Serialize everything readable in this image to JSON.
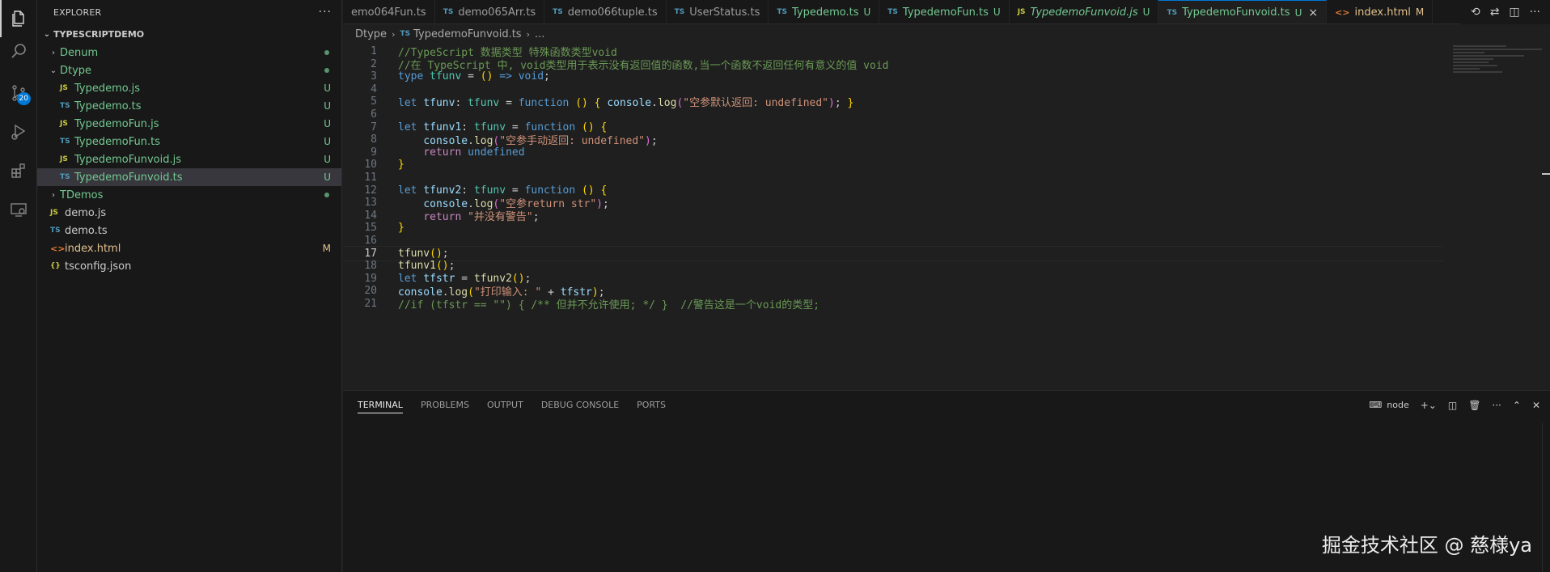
{
  "activity_bar": {
    "items": [
      {
        "icon": "files-icon"
      },
      {
        "icon": "search-icon"
      },
      {
        "icon": "source-control-icon",
        "badge": "20"
      },
      {
        "icon": "run-debug-icon"
      },
      {
        "icon": "extensions-icon"
      },
      {
        "icon": "remote-explorer-icon"
      }
    ]
  },
  "sidebar": {
    "title": "EXPLORER",
    "more": "···",
    "section": "TYPESCRIPTDEMO",
    "tree": [
      {
        "name": "Denum",
        "type": "folder",
        "open": false,
        "indent": 1,
        "color": "green",
        "dot": true
      },
      {
        "name": "Dtype",
        "type": "folder",
        "open": true,
        "indent": 1,
        "color": "green",
        "dot": true
      },
      {
        "name": "Typedemo.js",
        "type": "js",
        "indent": 2,
        "color": "green",
        "status": "U"
      },
      {
        "name": "Typedemo.ts",
        "type": "ts",
        "indent": 2,
        "color": "green",
        "status": "U"
      },
      {
        "name": "TypedemoFun.js",
        "type": "js",
        "indent": 2,
        "color": "green",
        "status": "U"
      },
      {
        "name": "TypedemoFun.ts",
        "type": "ts",
        "indent": 2,
        "color": "green",
        "status": "U"
      },
      {
        "name": "TypedemoFunvoid.js",
        "type": "js",
        "indent": 2,
        "color": "green",
        "status": "U"
      },
      {
        "name": "TypedemoFunvoid.ts",
        "type": "ts",
        "indent": 2,
        "color": "green",
        "status": "U",
        "selected": true
      },
      {
        "name": "TDemos",
        "type": "folder",
        "open": false,
        "indent": 1,
        "color": "green",
        "dot": true
      },
      {
        "name": "demo.js",
        "type": "js",
        "indent": 1,
        "color": "plain"
      },
      {
        "name": "demo.ts",
        "type": "ts",
        "indent": 1,
        "color": "plain"
      },
      {
        "name": "index.html",
        "type": "html",
        "indent": 1,
        "color": "orange",
        "status": "M"
      },
      {
        "name": "tsconfig.json",
        "type": "json",
        "indent": 1,
        "color": "plain"
      }
    ]
  },
  "tabs": [
    {
      "label": "emo064Fun.ts",
      "type": "",
      "mod": ""
    },
    {
      "label": "demo065Arr.ts",
      "type": "ts",
      "mod": ""
    },
    {
      "label": "demo066tuple.ts",
      "type": "ts",
      "mod": ""
    },
    {
      "label": "UserStatus.ts",
      "type": "ts",
      "mod": ""
    },
    {
      "label": "Typedemo.ts",
      "type": "ts",
      "mod": "U",
      "color": "green"
    },
    {
      "label": "TypedemoFun.ts",
      "type": "ts",
      "mod": "U",
      "color": "green"
    },
    {
      "label": "TypedemoFunvoid.js",
      "type": "js",
      "mod": "U",
      "color": "green",
      "italic": true
    },
    {
      "label": "TypedemoFunvoid.ts",
      "type": "ts",
      "mod": "U",
      "color": "green",
      "active": true
    },
    {
      "label": "index.html",
      "type": "html",
      "mod": "M",
      "color": "orange"
    }
  ],
  "tab_type_labels": {
    "ts": "TS",
    "js": "JS",
    "html": "<>"
  },
  "tab_close": "×",
  "breadcrumb": {
    "folder": "Dtype",
    "file_icon": "TS",
    "file": "TypedemoFunvoid.ts",
    "more": "..."
  },
  "editor": {
    "current_line": 17,
    "lines": [
      [
        [
          "c-cm",
          "//TypeScript 数据类型 特殊函数类型void"
        ]
      ],
      [
        [
          "c-cm",
          "//在 TypeScript 中, void类型用于表示没有返回值的函数,当一个函数不返回任何有意义的值 void"
        ]
      ],
      [
        [
          "c-kw",
          "type"
        ],
        [
          "c-p",
          " "
        ],
        [
          "c-type",
          "tfunv"
        ],
        [
          "c-p",
          " = "
        ],
        [
          "c-br",
          "()"
        ],
        [
          "c-p",
          " "
        ],
        [
          "c-kw",
          "=>"
        ],
        [
          "c-p",
          " "
        ],
        [
          "c-kw",
          "void"
        ],
        [
          "c-p",
          ";"
        ]
      ],
      [],
      [
        [
          "c-kw",
          "let"
        ],
        [
          "c-p",
          " "
        ],
        [
          "c-var",
          "tfunv"
        ],
        [
          "c-p",
          ": "
        ],
        [
          "c-type",
          "tfunv"
        ],
        [
          "c-p",
          " = "
        ],
        [
          "c-kw",
          "function"
        ],
        [
          "c-p",
          " "
        ],
        [
          "c-br",
          "()"
        ],
        [
          "c-p",
          " "
        ],
        [
          "c-br",
          "{"
        ],
        [
          "c-p",
          " "
        ],
        [
          "c-var",
          "console"
        ],
        [
          "c-p",
          "."
        ],
        [
          "c-fn",
          "log"
        ],
        [
          "c-br2",
          "("
        ],
        [
          "c-str",
          "\"空参默认返回: undefined\""
        ],
        [
          "c-br2",
          ")"
        ],
        [
          "c-p",
          "; "
        ],
        [
          "c-br",
          "}"
        ]
      ],
      [],
      [
        [
          "c-kw",
          "let"
        ],
        [
          "c-p",
          " "
        ],
        [
          "c-var",
          "tfunv1"
        ],
        [
          "c-p",
          ": "
        ],
        [
          "c-type",
          "tfunv"
        ],
        [
          "c-p",
          " = "
        ],
        [
          "c-kw",
          "function"
        ],
        [
          "c-p",
          " "
        ],
        [
          "c-br",
          "()"
        ],
        [
          "c-p",
          " "
        ],
        [
          "c-br",
          "{"
        ]
      ],
      [
        [
          "c-p",
          "    "
        ],
        [
          "c-var",
          "console"
        ],
        [
          "c-p",
          "."
        ],
        [
          "c-fn",
          "log"
        ],
        [
          "c-br2",
          "("
        ],
        [
          "c-str",
          "\"空参手动返回: undefined\""
        ],
        [
          "c-br2",
          ")"
        ],
        [
          "c-p",
          ";"
        ]
      ],
      [
        [
          "c-p",
          "    "
        ],
        [
          "c-kw2",
          "return"
        ],
        [
          "c-p",
          " "
        ],
        [
          "c-kw",
          "undefined"
        ]
      ],
      [
        [
          "c-br",
          "}"
        ]
      ],
      [],
      [
        [
          "c-kw",
          "let"
        ],
        [
          "c-p",
          " "
        ],
        [
          "c-var",
          "tfunv2"
        ],
        [
          "c-p",
          ": "
        ],
        [
          "c-type",
          "tfunv"
        ],
        [
          "c-p",
          " = "
        ],
        [
          "c-kw",
          "function"
        ],
        [
          "c-p",
          " "
        ],
        [
          "c-br",
          "()"
        ],
        [
          "c-p",
          " "
        ],
        [
          "c-br",
          "{"
        ]
      ],
      [
        [
          "c-p",
          "    "
        ],
        [
          "c-var",
          "console"
        ],
        [
          "c-p",
          "."
        ],
        [
          "c-fn",
          "log"
        ],
        [
          "c-br2",
          "("
        ],
        [
          "c-str",
          "\"空参return str\""
        ],
        [
          "c-br2",
          ")"
        ],
        [
          "c-p",
          ";"
        ]
      ],
      [
        [
          "c-p",
          "    "
        ],
        [
          "c-kw2",
          "return"
        ],
        [
          "c-p",
          " "
        ],
        [
          "c-str",
          "\"并没有警告\""
        ],
        [
          "c-p",
          ";"
        ]
      ],
      [
        [
          "c-br",
          "}"
        ]
      ],
      [],
      [
        [
          "c-fn",
          "tfunv"
        ],
        [
          "c-br",
          "()"
        ],
        [
          "c-p",
          ";"
        ]
      ],
      [
        [
          "c-fn",
          "tfunv1"
        ],
        [
          "c-br",
          "()"
        ],
        [
          "c-p",
          ";"
        ]
      ],
      [
        [
          "c-kw",
          "let"
        ],
        [
          "c-p",
          " "
        ],
        [
          "c-var",
          "tfstr"
        ],
        [
          "c-p",
          " = "
        ],
        [
          "c-fn",
          "tfunv2"
        ],
        [
          "c-br",
          "()"
        ],
        [
          "c-p",
          ";"
        ]
      ],
      [
        [
          "c-var",
          "console"
        ],
        [
          "c-p",
          "."
        ],
        [
          "c-fn",
          "log"
        ],
        [
          "c-br",
          "("
        ],
        [
          "c-str",
          "\"打印输入: \""
        ],
        [
          "c-p",
          " + "
        ],
        [
          "c-var",
          "tfstr"
        ],
        [
          "c-br",
          ")"
        ],
        [
          "c-p",
          ";"
        ]
      ],
      [
        [
          "c-cm",
          "//if (tfstr == \"\") { /** 但并不允许使用; */ }  //警告这是一个void的类型;"
        ]
      ]
    ]
  },
  "panel": {
    "tabs": [
      {
        "label": "TERMINAL",
        "active": true
      },
      {
        "label": "PROBLEMS"
      },
      {
        "label": "OUTPUT"
      },
      {
        "label": "DEBUG CONSOLE"
      },
      {
        "label": "PORTS"
      }
    ],
    "terminal_name": "node"
  },
  "watermark": "掘金技术社区 @ 慈様ya"
}
